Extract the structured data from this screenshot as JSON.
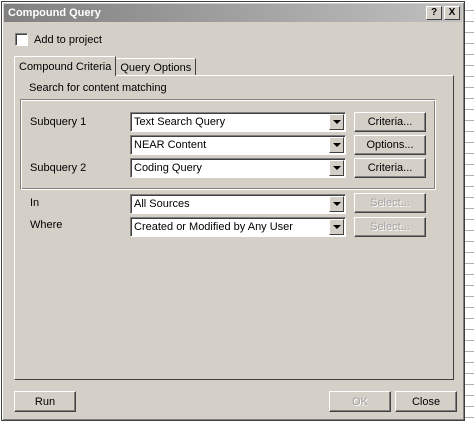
{
  "window": {
    "title": "Compound Query",
    "help_button": "?",
    "close_button": "X"
  },
  "add_to_project": {
    "label": "Add to project",
    "checked": false
  },
  "tabs": [
    {
      "label": "Compound Criteria",
      "active": true
    },
    {
      "label": "Query Options",
      "active": false
    }
  ],
  "search_group": {
    "caption": "Search for content matching",
    "subquery1": {
      "label": "Subquery 1",
      "value": "Text Search Query",
      "button": "Criteria..."
    },
    "operator": {
      "value": "NEAR Content",
      "button": "Options..."
    },
    "subquery2": {
      "label": "Subquery 2",
      "value": "Coding Query",
      "button": "Criteria..."
    }
  },
  "in_row": {
    "label": "In",
    "value": "All Sources",
    "button": "Select..."
  },
  "where_row": {
    "label": "Where",
    "value": "Created or Modified by Any User",
    "button": "Select..."
  },
  "footer": {
    "run": "Run",
    "ok": "OK",
    "close": "Close"
  },
  "colors": {
    "dialog_bg": "#d4d0c8",
    "title_gradient_start": "#808080",
    "title_gradient_end": "#c0c0c0",
    "disabled_text": "#a0a0a0"
  }
}
